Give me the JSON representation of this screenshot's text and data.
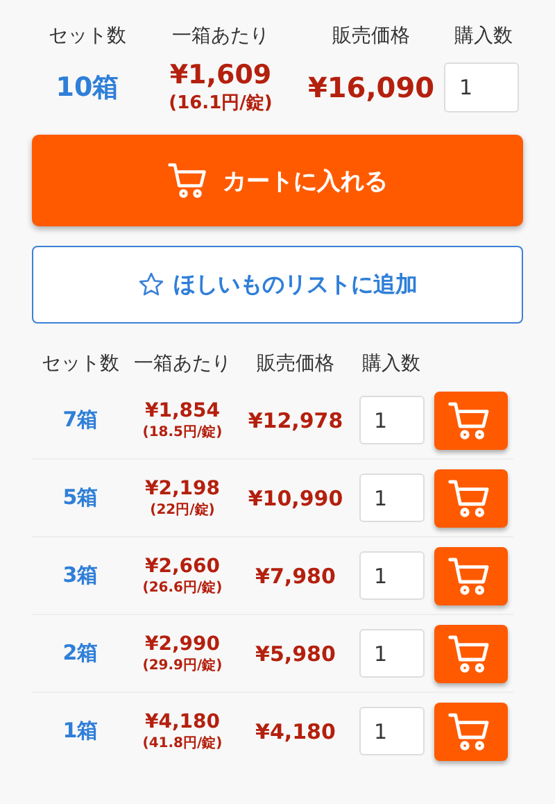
{
  "main_offer": {
    "headers": [
      "セット数",
      "一箱あたり",
      "販売価格",
      "購入数"
    ],
    "sets": "10箱",
    "unit_price": "¥1,609",
    "per_tablet": "(16.1円/錠)",
    "price": "¥16,090",
    "quantity": "1"
  },
  "cart_button": {
    "label": "カートに入れる"
  },
  "wishlist_button": {
    "label": "ほしいものリストに追加"
  },
  "table": {
    "columns": [
      "セット数",
      "一箱あたり",
      "販売価格",
      "購入数"
    ],
    "rows": [
      {
        "sets": "7箱",
        "unit_price": "¥1,854",
        "per_tablet": "(18.5円/錠)",
        "price": "¥12,978",
        "quantity": "1"
      },
      {
        "sets": "5箱",
        "unit_price": "¥2,198",
        "per_tablet": "(22円/錠)",
        "price": "¥10,990",
        "quantity": "1"
      },
      {
        "sets": "3箱",
        "unit_price": "¥2,660",
        "per_tablet": "(26.6円/錠)",
        "price": "¥7,980",
        "quantity": "1"
      },
      {
        "sets": "2箱",
        "unit_price": "¥2,990",
        "per_tablet": "(29.9円/錠)",
        "price": "¥5,980",
        "quantity": "1"
      },
      {
        "sets": "1箱",
        "unit_price": "¥4,180",
        "per_tablet": "(41.8円/錠)",
        "price": "¥4,180",
        "quantity": "1"
      }
    ]
  }
}
